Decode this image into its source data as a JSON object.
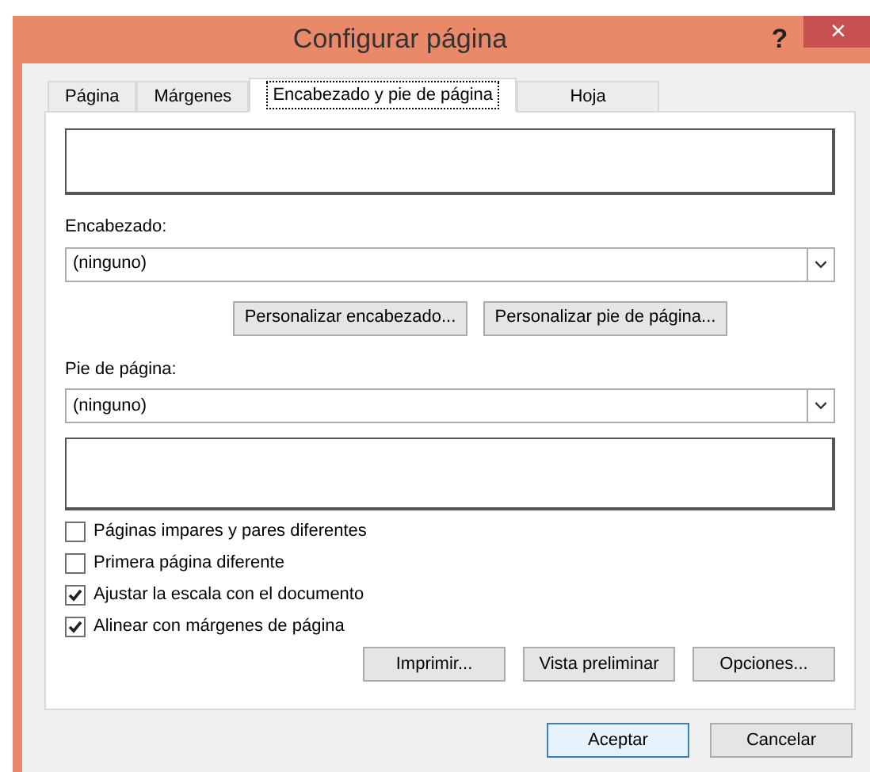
{
  "window": {
    "title": "Configurar página",
    "help": "?",
    "close": "×"
  },
  "tabs": [
    {
      "label": "Página",
      "selected": false
    },
    {
      "label": "Márgenes",
      "selected": false
    },
    {
      "label": "Encabezado y pie de página",
      "selected": true
    },
    {
      "label": "Hoja",
      "selected": false
    }
  ],
  "header": {
    "label": "Encabezado:",
    "value": "(ninguno)"
  },
  "custom_buttons": [
    "Personalizar encabezado...",
    "Personalizar pie de página..."
  ],
  "footer": {
    "label": "Pie de página:",
    "value": "(ninguno)"
  },
  "options": [
    {
      "label": "Páginas impares y pares diferentes",
      "checked": false
    },
    {
      "label": "Primera página diferente",
      "checked": false
    },
    {
      "label": "Ajustar la escala con el documento",
      "checked": true
    },
    {
      "label": "Alinear con márgenes de página",
      "checked": true
    }
  ],
  "panel_buttons": [
    "Imprimir...",
    "Vista preliminar",
    "Opciones..."
  ],
  "dialog_buttons": [
    {
      "label": "Aceptar",
      "default": true
    },
    {
      "label": "Cancelar",
      "default": false
    }
  ]
}
